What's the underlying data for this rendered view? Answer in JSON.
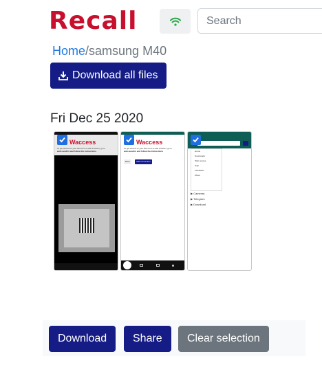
{
  "header": {
    "logo": "Recall",
    "wifi_icon": "wifi-icon",
    "search_placeholder": "Search"
  },
  "breadcrumb": {
    "home": "Home",
    "separator": "/",
    "current": "samsung M40"
  },
  "download_all": {
    "label": "Download all files",
    "icon": "download-icon"
  },
  "group": {
    "date": "Fri Dec 25 2020",
    "thumbnails": [
      {
        "id": "screenshot-1",
        "selected": true
      },
      {
        "id": "screenshot-2",
        "selected": true
      },
      {
        "id": "screenshot-3",
        "selected": true
      }
    ]
  },
  "thumb_text": {
    "title_access": "access",
    "title_prefix": "W",
    "menu": [
      "Home",
      "Downloads",
      "Web access",
      "Help",
      "Feedback",
      "About"
    ],
    "folders": [
      "Cameras",
      "Telegram",
      "Download"
    ],
    "btn_back": "Back",
    "btn_add": "Add connection"
  },
  "footer": {
    "download": "Download",
    "share": "Share",
    "clear": "Clear selection"
  },
  "colors": {
    "brand_red": "#c8102e",
    "primary": "#151c85",
    "secondary": "#6c757d",
    "link": "#1f7ae0",
    "wifi": "#28a745"
  }
}
